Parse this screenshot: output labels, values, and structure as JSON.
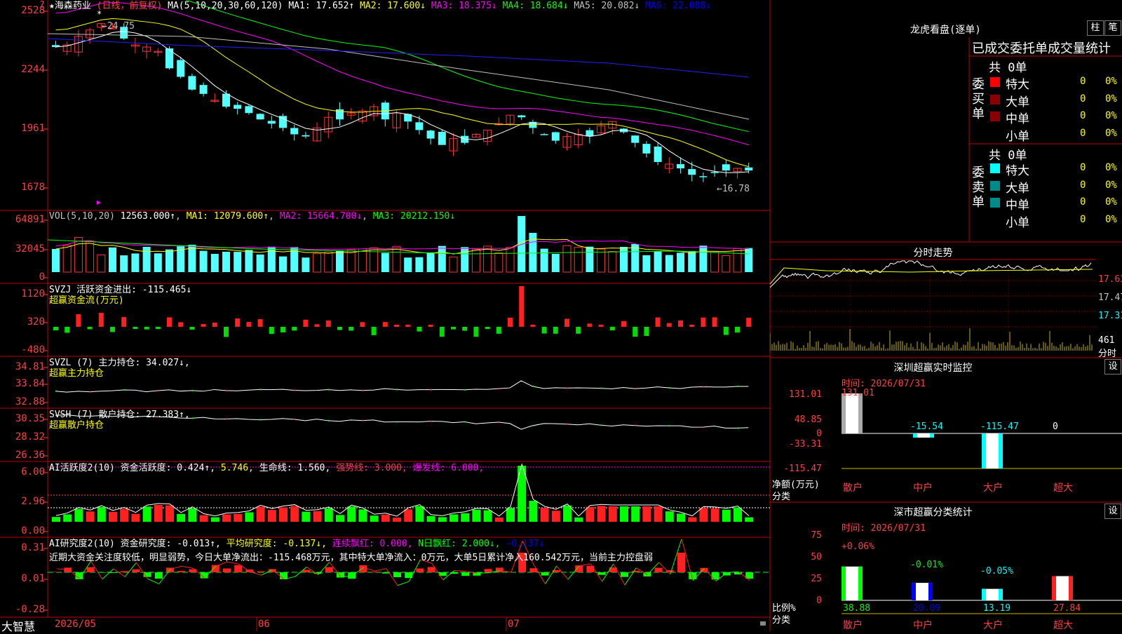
{
  "main": {
    "stock_name": "★海森药业",
    "period": "(日线，前复权)",
    "ma_header": "MA(5,10,20,30,60,120)",
    "ma_values": [
      {
        "label": "MA1:",
        "value": "17.652↑",
        "color": "#ffffff"
      },
      {
        "label": "MA2:",
        "value": "17.600↓",
        "color": "#ffff00"
      },
      {
        "label": "MA3:",
        "value": "18.375↓",
        "color": "#ff00ff"
      },
      {
        "label": "MA4:",
        "value": "18.684↓",
        "color": "#00ff00"
      },
      {
        "label": "MA5:",
        "value": "20.082↓",
        "color": "#c0c0c0"
      },
      {
        "label": "MA6:",
        "value": "22.088↓",
        "color": "#0000ff"
      }
    ],
    "y_ticks": [
      "2528",
      "2244",
      "1961",
      "1678"
    ],
    "high_label": "←24.75",
    "low_label": "←16.78",
    "top_marker": "?"
  },
  "vol": {
    "title": "VOL(5,10,20)",
    "value": "12563.000↑",
    "ma1": "MA1: 12079.600↑",
    "ma2": "MA2: 15664.700↓",
    "ma3": "MA3: 20212.150↓",
    "y_ticks": [
      "64891",
      "32045",
      "0"
    ]
  },
  "svzj": {
    "title": "SVZJ  活跃资金进出: -115.465↓",
    "subtitle": "超赢资金流(万元)",
    "y_ticks": [
      "1120",
      "320",
      "-480"
    ]
  },
  "svzl": {
    "title": "SVZL (7) 主力持仓: 34.027↓,",
    "subtitle": "超赢主力持仓",
    "y_ticks": [
      "34.81",
      "33.84",
      "32.88"
    ]
  },
  "svsh": {
    "title": "SVSH (7) 散户持仓: 27.383↑,",
    "subtitle": "超赢散户持仓",
    "y_ticks": [
      "30.35",
      "28.32",
      "26.36"
    ]
  },
  "ai_active": {
    "title": "AI活跃度2(10) 资金活跃度: 0.424↑,",
    "v1": "5.746,",
    "v2": "生命线: 1.560,",
    "v3": "强势线: 3.000,",
    "v4": "爆发线: 6.000,",
    "y_ticks": [
      "6.00",
      "2.96",
      "0.00"
    ]
  },
  "ai_research": {
    "title": "AI研究度2(10) 资金研究度: -0.013↑,",
    "v1": "平均研究度: -0.137↓,",
    "v2": "连续飘红: 0.000,",
    "v3": "N日飘红: 2.000↓,",
    "v4": "-0.137↓",
    "comment": "近期大资金关注度较低，明显弱势，今日大单净流出：-115.468万元，其中特大单净流入：0万元，大单5日累计净入160.542万元，当前主力控盘弱",
    "y_ticks": [
      "0.31",
      "0.01",
      "-0.28"
    ]
  },
  "bottom": {
    "brand": "大智慧",
    "dates": [
      "2026/05",
      "06",
      "07"
    ]
  },
  "longhu": {
    "title": "龙虎看盘(逐单)",
    "btn1": "柱",
    "btn2": "笔",
    "subtitle": "已成交委托单成交量统计",
    "buy_label": "委买单",
    "sell_label": "委卖单",
    "buy_total": "共 0单",
    "sell_total": "共 0单",
    "rows": [
      "特大",
      "大单",
      "中单",
      "小单"
    ],
    "buy_colors": [
      "#ff0000",
      "#8b0000",
      "#8b0000",
      ""
    ],
    "sell_colors": [
      "#00ffff",
      "#008b8b",
      "#008b8b",
      ""
    ],
    "zero": "0",
    "pct": "0%"
  },
  "fenshi": {
    "title": "分时走势",
    "y_ticks": [
      "17.63",
      "17.47",
      "17.31"
    ],
    "vol_label": "461",
    "vol_unit": "分时"
  },
  "monitor": {
    "title": "深圳超赢实时监控",
    "settings": "设",
    "time": "时间: 2026/07/31",
    "y_ticks": [
      "131.01",
      "48.85",
      "0",
      "-33.31",
      "-115.47"
    ],
    "values": [
      "131.01",
      "-15.54",
      "-115.47",
      "0"
    ],
    "ylabel": "净额(万元)",
    "xlabel": "分类",
    "categories": [
      "散户",
      "中户",
      "大户",
      "超大"
    ]
  },
  "classify": {
    "title": "深市超赢分类统计",
    "settings": "设",
    "time": "时间: 2026/07/31",
    "y_ticks": [
      "75",
      "50",
      "25",
      "0"
    ],
    "changes": [
      "+0.06%",
      "-0.01%",
      "-0.05%"
    ],
    "values": [
      "38.88",
      "20.09",
      "13.19",
      "27.84"
    ],
    "ylabel": "比例%",
    "xlabel": "分类",
    "categories": [
      "散户",
      "中户",
      "大户",
      "超大"
    ]
  }
}
